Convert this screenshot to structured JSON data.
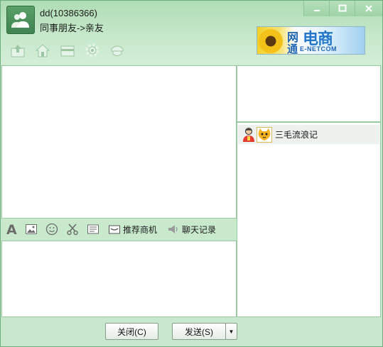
{
  "window": {
    "name_line": "dd(10386366)",
    "group_line": "同事朋友->亲友",
    "controls": [
      "minimize-icon",
      "maximize-icon",
      "close-icon"
    ]
  },
  "top_toolbar": {
    "icons": [
      "upload-icon",
      "home-icon",
      "wallet-icon",
      "gear-icon",
      "police-cap-icon"
    ]
  },
  "banner": {
    "line1a": "网",
    "line1b": "电商",
    "line2a": "通",
    "line2b": "E-NETCOM"
  },
  "input_toolbar": {
    "icons": [
      "font-icon",
      "image-icon",
      "emoji-icon",
      "scissors-icon",
      "document-icon"
    ],
    "recommend_label": "推荐商机",
    "history_label": "聊天记录"
  },
  "members": [
    {
      "name": "三毛流浪记"
    }
  ],
  "buttons": {
    "close_label": "关闭(C)",
    "send_label": "发送(S)",
    "send_arrow": "▼"
  },
  "colors": {
    "window_green": "#c7e8cc",
    "avatar_green": "#4a9159",
    "border_green": "#9bc9a3"
  }
}
